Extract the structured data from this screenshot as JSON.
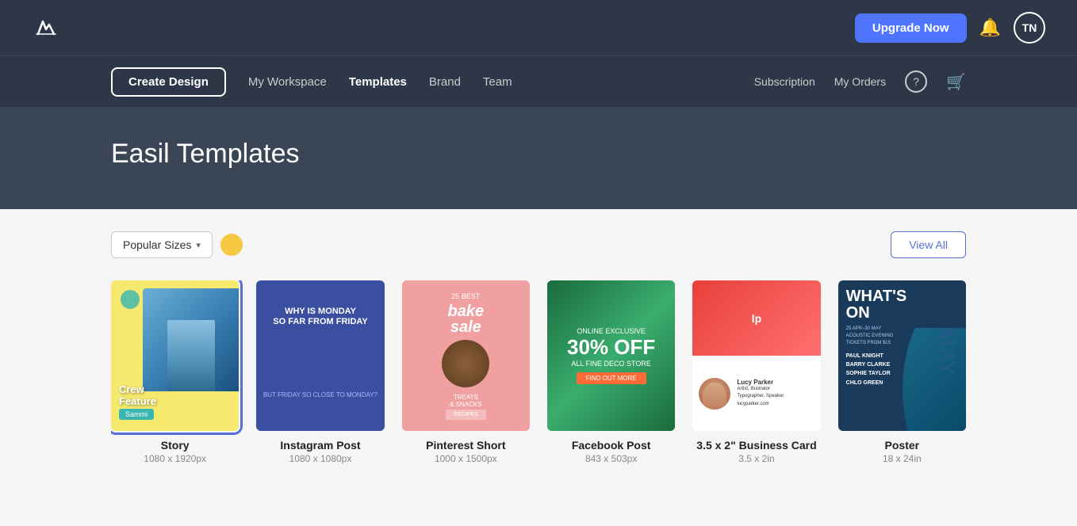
{
  "header": {
    "upgrade_label": "Upgrade Now",
    "bell_icon": "bell",
    "avatar_initials": "TN"
  },
  "navbar": {
    "create_design_label": "Create Design",
    "nav_items": [
      {
        "label": "My Workspace",
        "active": false
      },
      {
        "label": "Templates",
        "active": true
      },
      {
        "label": "Brand",
        "active": false
      },
      {
        "label": "Team",
        "active": false
      }
    ],
    "right_links": [
      {
        "label": "Subscription"
      },
      {
        "label": "My Orders"
      }
    ],
    "help_icon": "question-mark",
    "cart_icon": "shopping-cart"
  },
  "hero": {
    "title": "Easil Templates"
  },
  "filters": {
    "popular_sizes_label": "Popular Sizes",
    "view_all_label": "View All"
  },
  "templates": [
    {
      "name": "Story",
      "size": "1080 x 1920px",
      "type": "story",
      "selected": true
    },
    {
      "name": "Instagram Post",
      "size": "1080 x 1080px",
      "type": "instagram",
      "selected": false
    },
    {
      "name": "Pinterest Short",
      "size": "1000 x 1500px",
      "type": "pinterest",
      "selected": false
    },
    {
      "name": "Facebook Post",
      "size": "843 x 503px",
      "type": "facebook",
      "selected": false
    },
    {
      "name": "3.5 x 2\" Business Card",
      "size": "3.5 x 2in",
      "type": "bizcard",
      "selected": false
    },
    {
      "name": "Poster",
      "size": "18 x 24in",
      "type": "poster",
      "selected": false
    }
  ]
}
